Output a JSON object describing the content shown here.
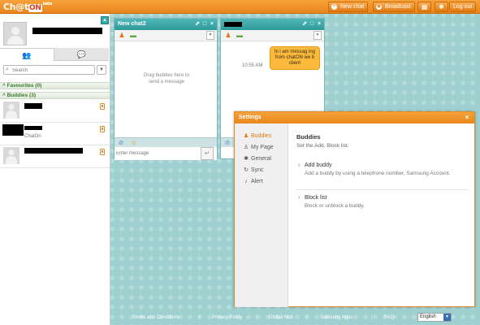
{
  "app": {
    "logo_text": "Ch@t",
    "logo_on": "ON",
    "logo_beta": "beta"
  },
  "topbar": {
    "new_chat_label": "New chat",
    "broadcast_label": "Broadcast",
    "logout_label": "Log out"
  },
  "left_panel": {
    "search_placeholder": "Search",
    "favourites_label": "Favourites (0)",
    "buddies_label": "Buddies (3)",
    "buddies": [
      {
        "status": ""
      },
      {
        "status": "ChatOn"
      },
      {
        "status": ""
      }
    ]
  },
  "chat_windows": [
    {
      "title": "New chat2",
      "hint": "Drag buddies here to send a message",
      "input_placeholder": "Enter message"
    },
    {
      "message": "hi i am messag ing from chatON we b client",
      "time": "10:55 AM"
    }
  ],
  "settings": {
    "title": "Settings",
    "nav": [
      {
        "label": "Buddies",
        "icon": "buddies-icon"
      },
      {
        "label": "My Page",
        "icon": "person-icon"
      },
      {
        "label": "General",
        "icon": "gear-icon"
      },
      {
        "label": "Sync",
        "icon": "sync-icon"
      },
      {
        "label": "Alert",
        "icon": "bell-icon"
      }
    ],
    "heading": "Buddies",
    "subheading": "Set the Add, Block list.",
    "options": [
      {
        "label": "Add buddy",
        "description": "Add a buddy by using a telephone number, Samsung Account."
      },
      {
        "label": "Block list",
        "description": "Block or unblock a buddy."
      }
    ]
  },
  "footer": {
    "links": [
      "Terms and Conditions",
      "Privacy Policy",
      "Global Hub",
      "Samsung Apps",
      "FAQ"
    ],
    "language": "English"
  },
  "colors": {
    "accent_orange": "#f08c1e",
    "teal": "#3aa9a9",
    "background_teal": "#9fd0d0"
  }
}
